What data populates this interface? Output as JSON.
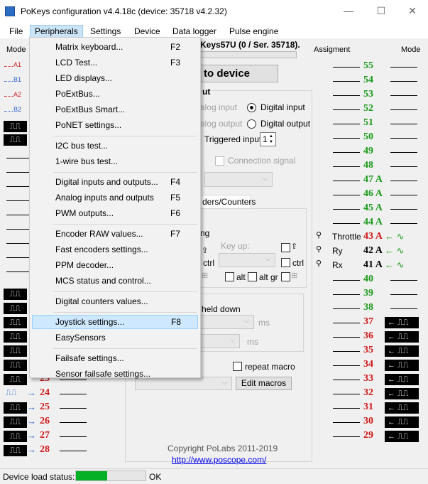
{
  "window": {
    "title": "PoKeys configuration v4.4.18c (device: 35718 v4.2.32)",
    "minimize": "—",
    "maximize": "☐",
    "close": "✕"
  },
  "menubar": {
    "items": [
      {
        "label": "File"
      },
      {
        "label": "Peripherals"
      },
      {
        "label": "Settings"
      },
      {
        "label": "Device"
      },
      {
        "label": "Data logger"
      },
      {
        "label": "Pulse engine"
      }
    ]
  },
  "headers": {
    "left_mode": "Mode",
    "assignment": "Assigment",
    "right_mode": "Mode"
  },
  "device_label": "Keys57U (0 / Ser. 35718).",
  "send_button": "to device",
  "group_title": "ut",
  "radios": {
    "analog_input": "alog input",
    "digital_input": "Digital input",
    "analog_output": "alog output",
    "digital_output": "Digital output"
  },
  "triggered_input": {
    "label": "Triggered input",
    "value": "1"
  },
  "connection_signal": "Connection signal",
  "tab_label": "ders/Counters",
  "keys": {
    "partial_label": "ng",
    "ctrl1": "ctrl",
    "key_up": "Key up:",
    "ctrl2": "ctrl",
    "alt": "alt",
    "alt_gr": "alt gr"
  },
  "held_down": "held down",
  "ms1": "ms",
  "ms2": "ms",
  "repeat_macro": "repeat macro",
  "edit_macros": "Edit macros",
  "copyright": "Copyright PoLabs 2011-2019",
  "website": "http://www.poscope.com/",
  "status": {
    "label": "Device load status:",
    "value": "OK",
    "progress": 0.45
  },
  "left_indicators": [
    {
      "label": "A1",
      "color": "#d01818"
    },
    {
      "label": "B1",
      "color": "#2a5fd0"
    },
    {
      "label": "A2",
      "color": "#d01818"
    },
    {
      "label": "B2",
      "color": "#2a5fd0"
    }
  ],
  "left_pins": [
    {
      "num": "23",
      "color": "#d01818"
    },
    {
      "num": "24",
      "color": "#d01818"
    },
    {
      "num": "25",
      "color": "#d01818"
    },
    {
      "num": "26",
      "color": "#d01818"
    },
    {
      "num": "27",
      "color": "#d01818"
    },
    {
      "num": "28",
      "color": "#d01818"
    }
  ],
  "right_pins": [
    {
      "num": "55",
      "color": "#1b9a1b"
    },
    {
      "num": "54",
      "color": "#1b9a1b"
    },
    {
      "num": "53",
      "color": "#1b9a1b"
    },
    {
      "num": "52",
      "color": "#1b9a1b"
    },
    {
      "num": "51",
      "color": "#1b9a1b"
    },
    {
      "num": "50",
      "color": "#1b9a1b"
    },
    {
      "num": "49",
      "color": "#1b9a1b"
    },
    {
      "num": "48",
      "color": "#1b9a1b"
    },
    {
      "num": "47 A",
      "color": "#1b9a1b"
    },
    {
      "num": "46 A",
      "color": "#1b9a1b"
    },
    {
      "num": "45 A",
      "color": "#1b9a1b"
    },
    {
      "num": "44 A",
      "color": "#1b9a1b"
    },
    {
      "num": "43 A",
      "color": "#d01818",
      "assign": "Throttle"
    },
    {
      "num": "42 A",
      "color": "#000000",
      "assign": "Ry"
    },
    {
      "num": "41 A",
      "color": "#000000",
      "assign": "Rx"
    },
    {
      "num": "40",
      "color": "#1b9a1b"
    },
    {
      "num": "39",
      "color": "#1b9a1b"
    },
    {
      "num": "38",
      "color": "#1b9a1b"
    },
    {
      "num": "37",
      "color": "#d01818"
    },
    {
      "num": "36",
      "color": "#d01818"
    },
    {
      "num": "35",
      "color": "#d01818"
    },
    {
      "num": "34",
      "color": "#d01818"
    },
    {
      "num": "33",
      "color": "#d01818"
    },
    {
      "num": "32",
      "color": "#d01818"
    },
    {
      "num": "31",
      "color": "#d01818"
    },
    {
      "num": "30",
      "color": "#d01818"
    },
    {
      "num": "29",
      "color": "#d01818"
    }
  ],
  "peripherals_menu": {
    "items": [
      {
        "label": "Matrix keyboard...",
        "shortcut": "F2"
      },
      {
        "label": "LCD Test...",
        "shortcut": "F3"
      },
      {
        "label": "LED displays...",
        "shortcut": ""
      },
      {
        "label": "PoExtBus...",
        "shortcut": ""
      },
      {
        "label": "PoExtBus Smart...",
        "shortcut": ""
      },
      {
        "label": "PoNET settings...",
        "shortcut": ""
      },
      {
        "label": "I2C bus test...",
        "shortcut": ""
      },
      {
        "label": "1-wire bus test...",
        "shortcut": ""
      },
      {
        "label": "Digital inputs and outputs...",
        "shortcut": "F4"
      },
      {
        "label": "Analog inputs and outputs",
        "shortcut": "F5"
      },
      {
        "label": "PWM outputs...",
        "shortcut": "F6"
      },
      {
        "label": "Encoder RAW values...",
        "shortcut": "F7"
      },
      {
        "label": "Fast encoders settings...",
        "shortcut": ""
      },
      {
        "label": "PPM decoder...",
        "shortcut": ""
      },
      {
        "label": "MCS status and control...",
        "shortcut": ""
      },
      {
        "label": "Digital counters values...",
        "shortcut": ""
      },
      {
        "label": "Joystick settings...",
        "shortcut": "F8"
      },
      {
        "label": "EasySensors",
        "shortcut": ""
      },
      {
        "label": "Failsafe settings...",
        "shortcut": ""
      },
      {
        "label": "Sensor failsafe settings...",
        "shortcut": ""
      }
    ]
  }
}
